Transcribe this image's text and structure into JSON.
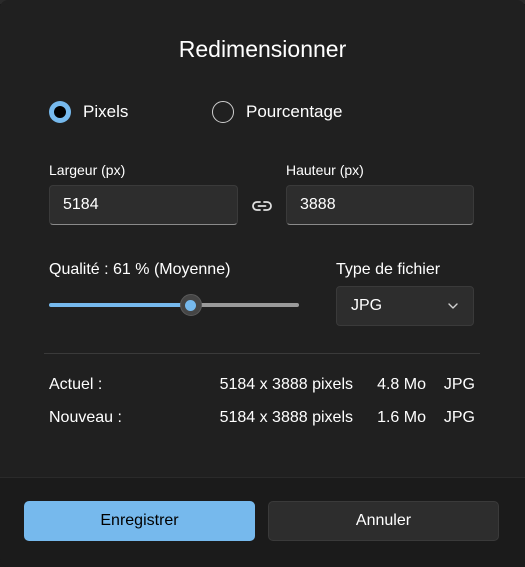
{
  "dialog": {
    "title": "Redimensionner",
    "mode_options": [
      {
        "label": "Pixels",
        "selected": true
      },
      {
        "label": "Pourcentage",
        "selected": false
      }
    ],
    "width": {
      "label": "Largeur  (px)",
      "value": "5184"
    },
    "height": {
      "label": "Hauteur  (px)",
      "value": "3888"
    },
    "link_icon": "link-icon",
    "quality": {
      "label": "Qualité : 61 % (Moyenne)",
      "value_percent": 61
    },
    "file_type": {
      "label": "Type de fichier",
      "selected": "JPG"
    },
    "info": [
      {
        "label": "Actuel :",
        "dimensions": "5184 x 3888 pixels",
        "size": "4.8 Mo",
        "format": "JPG"
      },
      {
        "label": "Nouveau :",
        "dimensions": "5184 x 3888 pixels",
        "size": "1.6 Mo",
        "format": "JPG"
      }
    ]
  },
  "footer": {
    "save_label": "Enregistrer",
    "cancel_label": "Annuler"
  },
  "colors": {
    "accent": "#76b9ed",
    "background": "#202020",
    "control": "#2d2d2d"
  }
}
